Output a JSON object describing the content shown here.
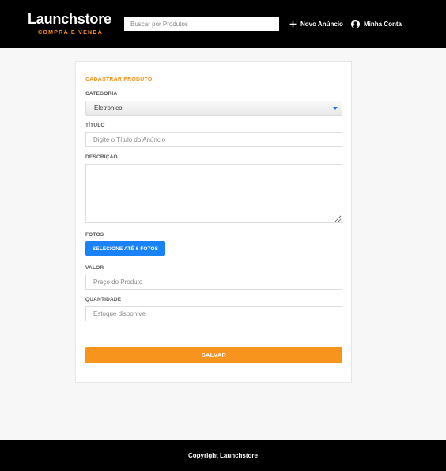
{
  "header": {
    "logo_title": "Launchstore",
    "logo_subtitle": "COMPRA E VENDA",
    "search_placeholder": "Buscar por Produtos",
    "new_ad_label": "Novo Anúncio",
    "account_label": "Minha Conta"
  },
  "form": {
    "title": "CADASTRAR PRODUTO",
    "category_label": "CATEGORIA",
    "category_value": "Eletronico",
    "title_label": "TÍTULO",
    "title_placeholder": "Digite o Título do Anúncio",
    "description_label": "DESCRIÇÃO",
    "photos_label": "FOTOS",
    "photos_button": "SELECIONE ATÉ 6 FOTOS",
    "price_label": "VALOR",
    "price_placeholder": "Preço do Produto",
    "quantity_label": "QUANTIDADE",
    "quantity_placeholder": "Estoque disponível",
    "save_button": "SALVAR"
  },
  "footer": {
    "copyright": "Copyright Launchstore"
  },
  "colors": {
    "accent": "#f7941d",
    "primary_button": "#1a82f7",
    "header_bg": "#000000"
  },
  "icons": {
    "new_ad": "plus-icon",
    "account": "user-circle-icon",
    "select": "caret-down-icon"
  }
}
